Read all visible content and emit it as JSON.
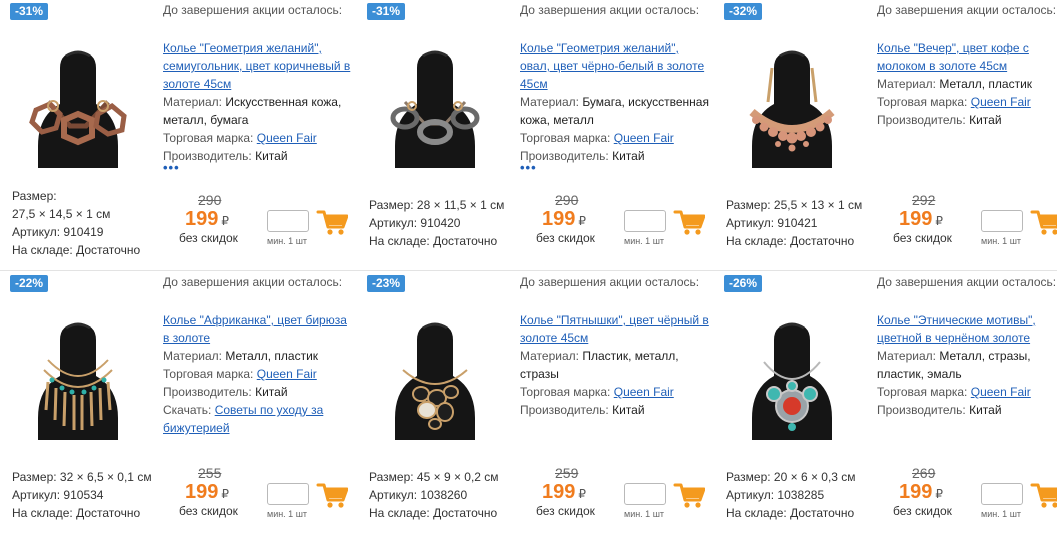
{
  "labels": {
    "countdown": "До завершения акции осталось:",
    "material": "Материал:",
    "brand": "Торговая марка:",
    "manufacturer": "Производитель:",
    "download": "Скачать:",
    "size": "Размер:",
    "article": "Артикул:",
    "stock": "На складе:",
    "no_discount": "без скидок",
    "min_qty": "мин. 1 шт",
    "currency": "₽",
    "more": "•••"
  },
  "colors": {
    "badge": "#3b8ed6",
    "link": "#1f5fb8",
    "price": "#f07c1e",
    "cart": "#f49a1e"
  },
  "products": [
    {
      "discount": "-31%",
      "title": "Колье \"Геометрия желаний\", семиугольник, цвет коричневый в золоте 45см",
      "material": "Искусственная кожа, металл, бумага",
      "brand": "Queen Fair",
      "manufacturer": "Китай",
      "size": "27,5 × 14,5 × 1 см",
      "article": "910419",
      "stock": "Достаточно",
      "old_price": "290",
      "price": "199",
      "image_icon": "necklace-octagon-brown-icon"
    },
    {
      "discount": "-31%",
      "title": "Колье \"Геометрия желаний\", овал, цвет чёрно-белый в золоте 45см",
      "material": "Бумага, искусственная кожа, металл",
      "brand": "Queen Fair",
      "manufacturer": "Китай",
      "size": "28 × 11,5 × 1 см",
      "article": "910420",
      "stock": "Достаточно",
      "old_price": "290",
      "price": "199",
      "image_icon": "necklace-oval-black-white-icon"
    },
    {
      "discount": "-32%",
      "title": "Колье \"Вечер\", цвет кофе с молоком в золоте 45см",
      "material": "Металл, пластик",
      "brand": "Queen Fair",
      "manufacturer": "Китай",
      "size": "25,5 × 13 × 1 см",
      "article": "910421",
      "stock": "Достаточно",
      "old_price": "292",
      "price": "199",
      "image_icon": "necklace-beads-coffee-icon"
    },
    {
      "discount": "-22%",
      "title": "Колье \"Африканка\", цвет бирюза в золоте",
      "material": "Металл, пластик",
      "brand": "Queen Fair",
      "manufacturer": "Китай",
      "download": "Советы по уходу за бижутерией",
      "size": "32 × 6,5 × 0,1 см",
      "article": "910534",
      "stock": "Достаточно",
      "old_price": "255",
      "price": "199",
      "image_icon": "necklace-fringe-turquoise-icon"
    },
    {
      "discount": "-23%",
      "title": "Колье \"Пятнышки\", цвет чёрный в золоте 45см",
      "material": "Пластик, металл, стразы",
      "brand": "Queen Fair",
      "manufacturer": "Китай",
      "size": "45 × 9 × 0,2 см",
      "article": "1038260",
      "stock": "Достаточно",
      "old_price": "259",
      "price": "199",
      "image_icon": "necklace-spots-black-icon"
    },
    {
      "discount": "-26%",
      "title": "Колье \"Этнические мотивы\", цветной в чернёном золоте",
      "material": "Металл, стразы, пластик, эмаль",
      "brand": "Queen Fair",
      "manufacturer": "Китай",
      "size": "20 × 6 × 0,3 см",
      "article": "1038285",
      "stock": "Достаточно",
      "old_price": "269",
      "price": "199",
      "image_icon": "necklace-ethnic-pendant-icon"
    }
  ]
}
